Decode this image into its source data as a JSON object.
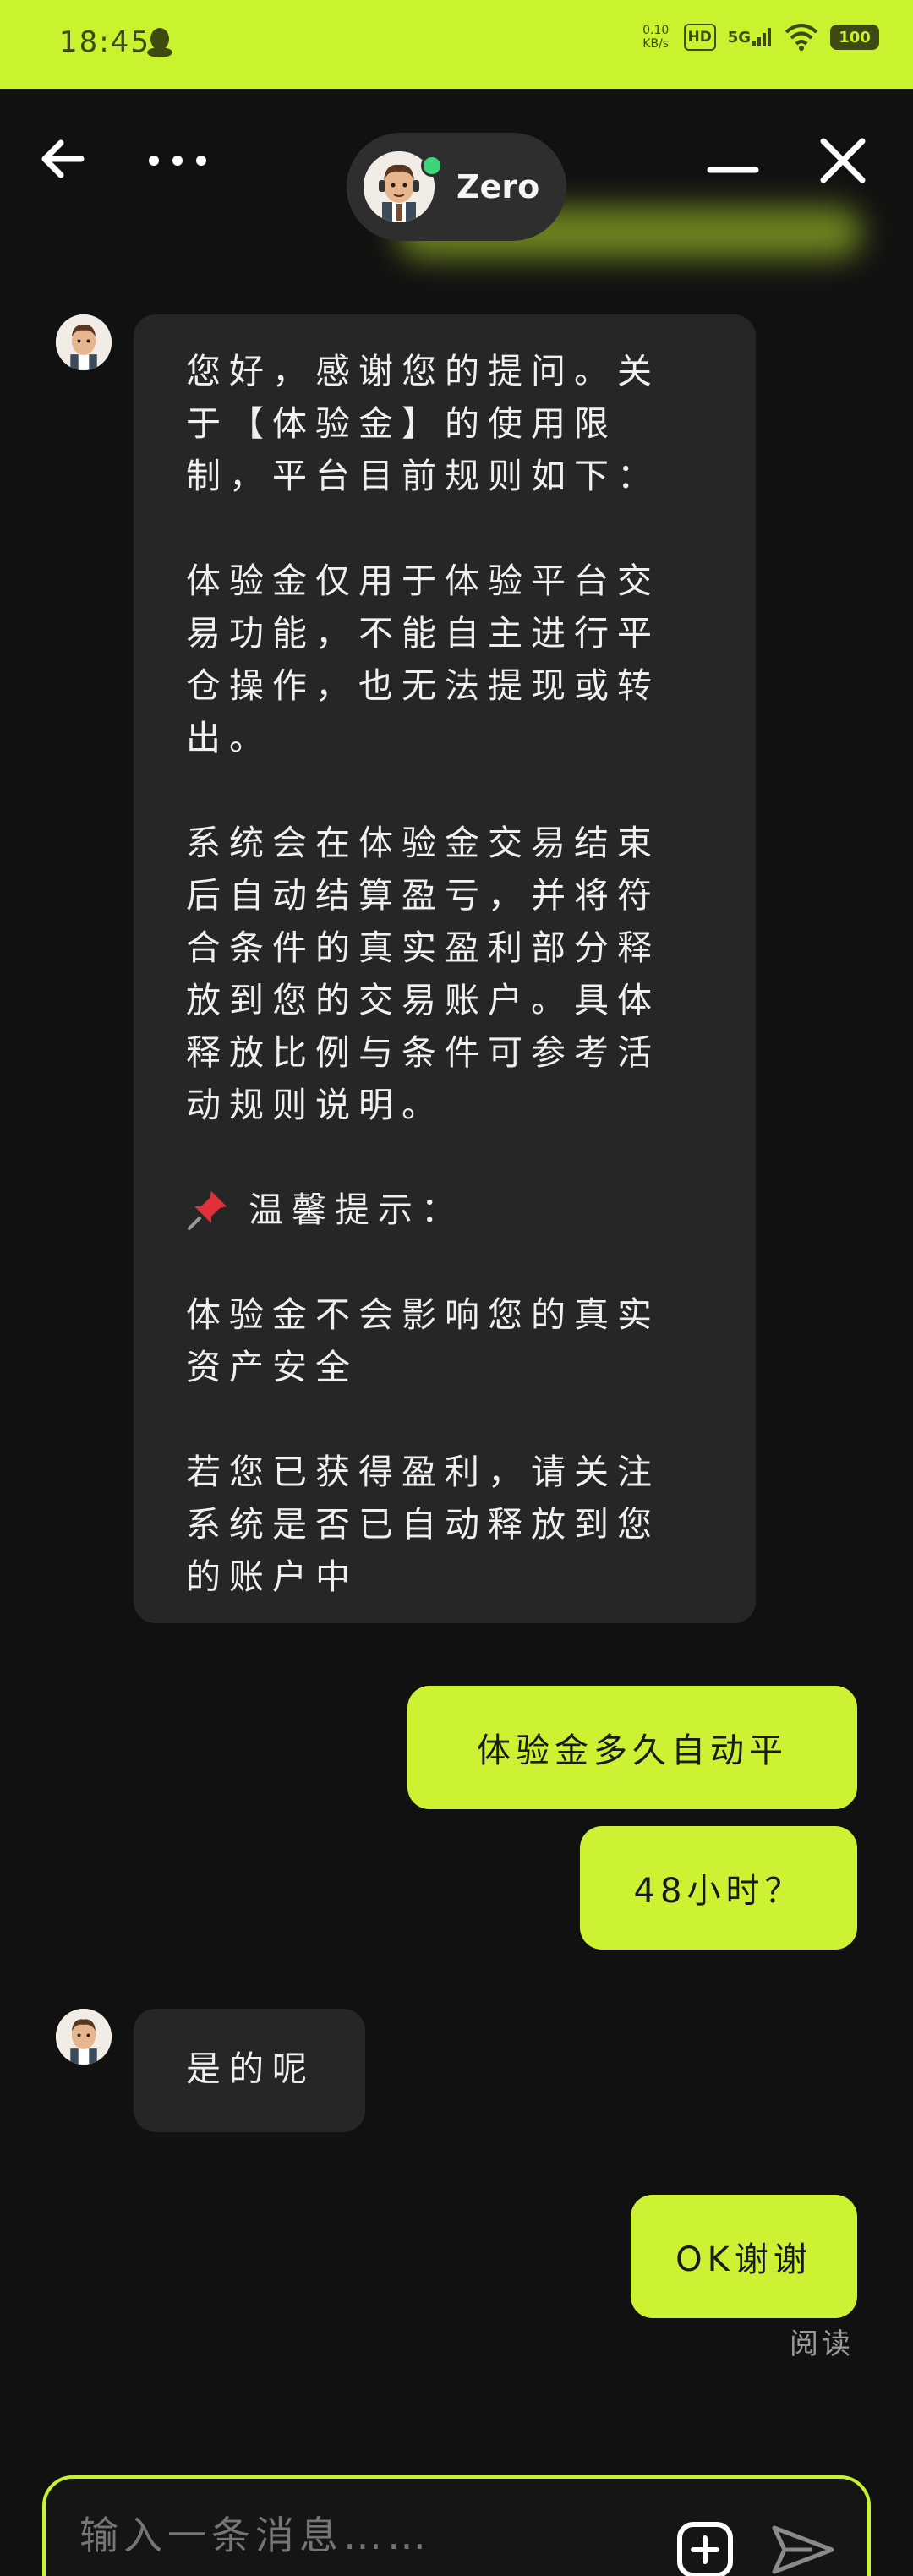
{
  "status_bar": {
    "time": "18:45",
    "net_speed_top": "0.10",
    "net_speed_bottom": "KB/s",
    "hd_badge": "HD",
    "signal_label": "5G",
    "battery": "100"
  },
  "header": {
    "agent_name": "Zero"
  },
  "messages": [
    {
      "sender": "agent",
      "paragraphs": [
        "您好，感谢您的提问。关于【体验金】的使用限制，平台目前规则如下：",
        "体验金仅用于体验平台交易功能，不能自主进行平仓操作，也无法提现或转出。",
        "系统会在体验金交易结束后自动结算盈亏，并将符合条件的真实盈利部分释放到您的交易账户。具体释放比例与条件可参考活动规则说明。",
        "温馨提示：",
        "体验金不会影响您的真实资产安全",
        "若您已获得盈利，请关注系统是否已自动释放到您的账户中"
      ]
    },
    {
      "sender": "user",
      "text": "体验金多久自动平"
    },
    {
      "sender": "user",
      "text": "48小时？"
    },
    {
      "sender": "agent",
      "text": "是的呢"
    },
    {
      "sender": "user",
      "text": "OK谢谢"
    }
  ],
  "read_status": "阅读",
  "input": {
    "placeholder": "输入一条消息……"
  },
  "colors": {
    "accent": "#cdf233",
    "background": "#111111",
    "bubble_in": "#262626",
    "online": "#3ed57a"
  },
  "icons": [
    "qq-icon",
    "back-arrow-icon",
    "more-dots-icon",
    "minimize-icon",
    "close-icon",
    "pushpin-icon",
    "add-icon",
    "send-icon"
  ]
}
